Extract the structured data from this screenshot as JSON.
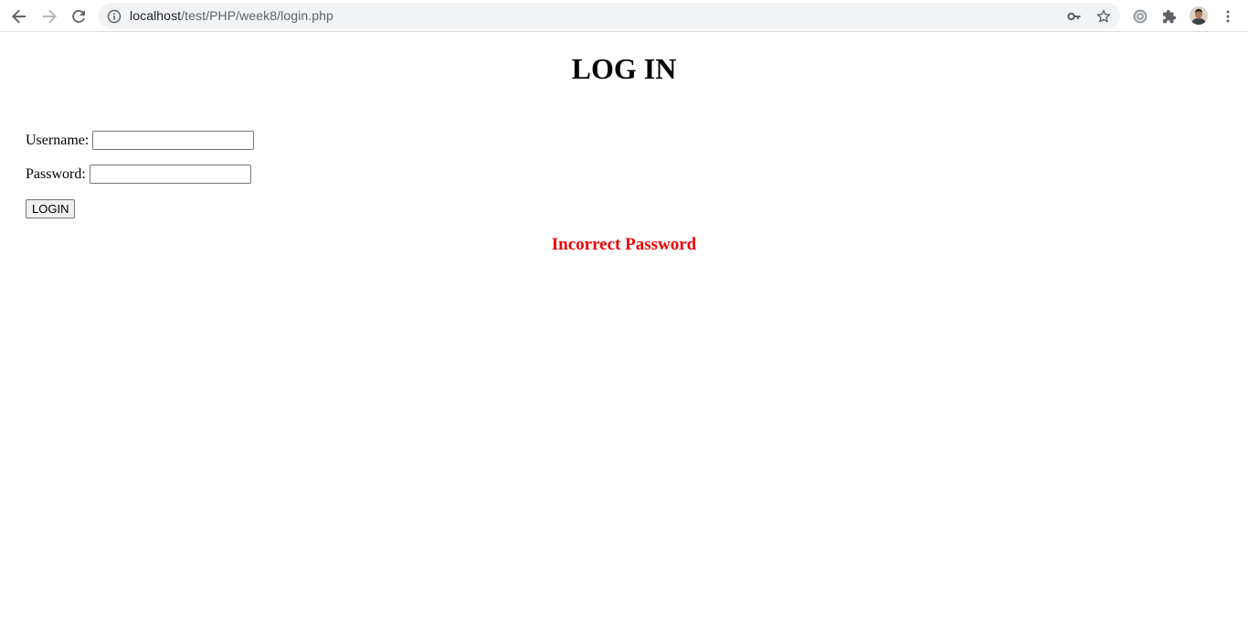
{
  "browser": {
    "url_host": "localhost",
    "url_path": "/test/PHP/week8/login.php",
    "icons": {
      "back": "arrow-left-icon",
      "forward": "arrow-right-icon",
      "reload": "reload-icon",
      "site_info": "info-icon",
      "password_key": "key-icon",
      "bookmark": "star-icon",
      "settings_ext": "gear-icon",
      "extensions": "puzzle-icon",
      "menu": "kebab-menu-icon"
    }
  },
  "page": {
    "title": "LOG IN",
    "form": {
      "username_label": "Username:",
      "username_value": "",
      "password_label": "Password:",
      "password_value": "",
      "submit_label": "LOGIN"
    },
    "error_message": "Incorrect Password",
    "error_color": "#ee0000"
  }
}
